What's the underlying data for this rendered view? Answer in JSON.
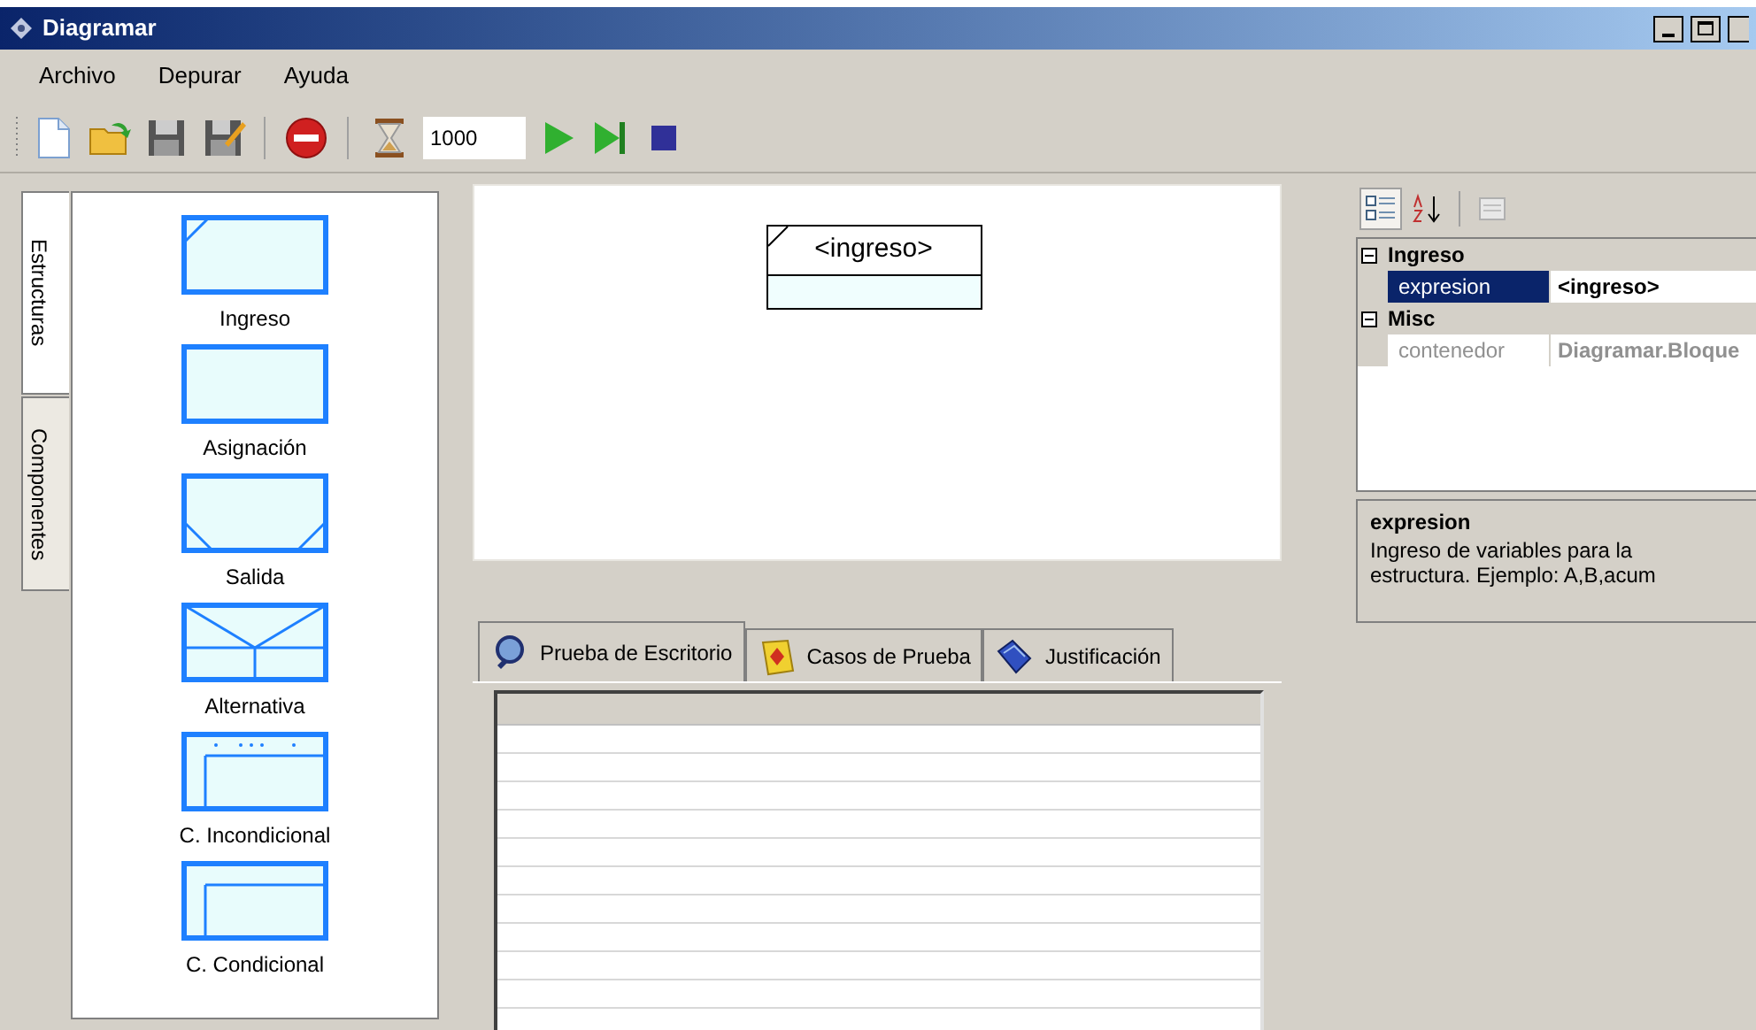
{
  "window": {
    "title": "Diagramar"
  },
  "menu": [
    "Archivo",
    "Depurar",
    "Ayuda"
  ],
  "toolbar": {
    "buttons": [
      {
        "kind": "new"
      },
      {
        "kind": "open"
      },
      {
        "kind": "save"
      },
      {
        "kind": "saveas"
      },
      {
        "kind": "sep"
      },
      {
        "kind": "stop"
      },
      {
        "kind": "sep"
      },
      {
        "kind": "timer"
      }
    ],
    "interval": "1000",
    "run_buttons": [
      {
        "kind": "play"
      },
      {
        "kind": "step"
      },
      {
        "kind": "halt"
      }
    ]
  },
  "side_tabs": [
    {
      "label": "Estructuras",
      "selected": true
    },
    {
      "label": "Componentes",
      "selected": false
    }
  ],
  "palette": [
    {
      "label": "Ingreso",
      "kind": "input"
    },
    {
      "label": "Asignación",
      "kind": "assign"
    },
    {
      "label": "Salida",
      "kind": "output"
    },
    {
      "label": "Alternativa",
      "kind": "alternative"
    },
    {
      "label": "C. Incondicional",
      "kind": "loop"
    },
    {
      "label": "C. Condicional",
      "kind": "while"
    }
  ],
  "canvas": {
    "block": {
      "text": "<ingreso>"
    }
  },
  "bottom_tabs": [
    {
      "label": "Prueba de Escritorio",
      "kind": "desk",
      "selected": true
    },
    {
      "label": "Casos de Prueba",
      "kind": "cases",
      "selected": false
    },
    {
      "label": "Justificación",
      "kind": "book",
      "selected": false
    }
  ],
  "properties": {
    "view_buttons": [
      {
        "kind": "categorized",
        "selected": true
      },
      {
        "kind": "alphabetical",
        "selected": false
      },
      {
        "kind": "pages",
        "selected": false
      }
    ],
    "categories": [
      {
        "name": "Ingreso",
        "expanded": true,
        "items": [
          {
            "name": "expresion",
            "value": "<ingreso>",
            "selected": true,
            "disabled": false
          }
        ]
      },
      {
        "name": "Misc",
        "expanded": true,
        "items": [
          {
            "name": "contenedor",
            "value": "Diagramar.Bloque",
            "selected": false,
            "disabled": true
          }
        ]
      }
    ],
    "description": {
      "title": "expresion",
      "text": "Ingreso de variables para la estructura. Ejemplo: A,B,acum"
    }
  }
}
